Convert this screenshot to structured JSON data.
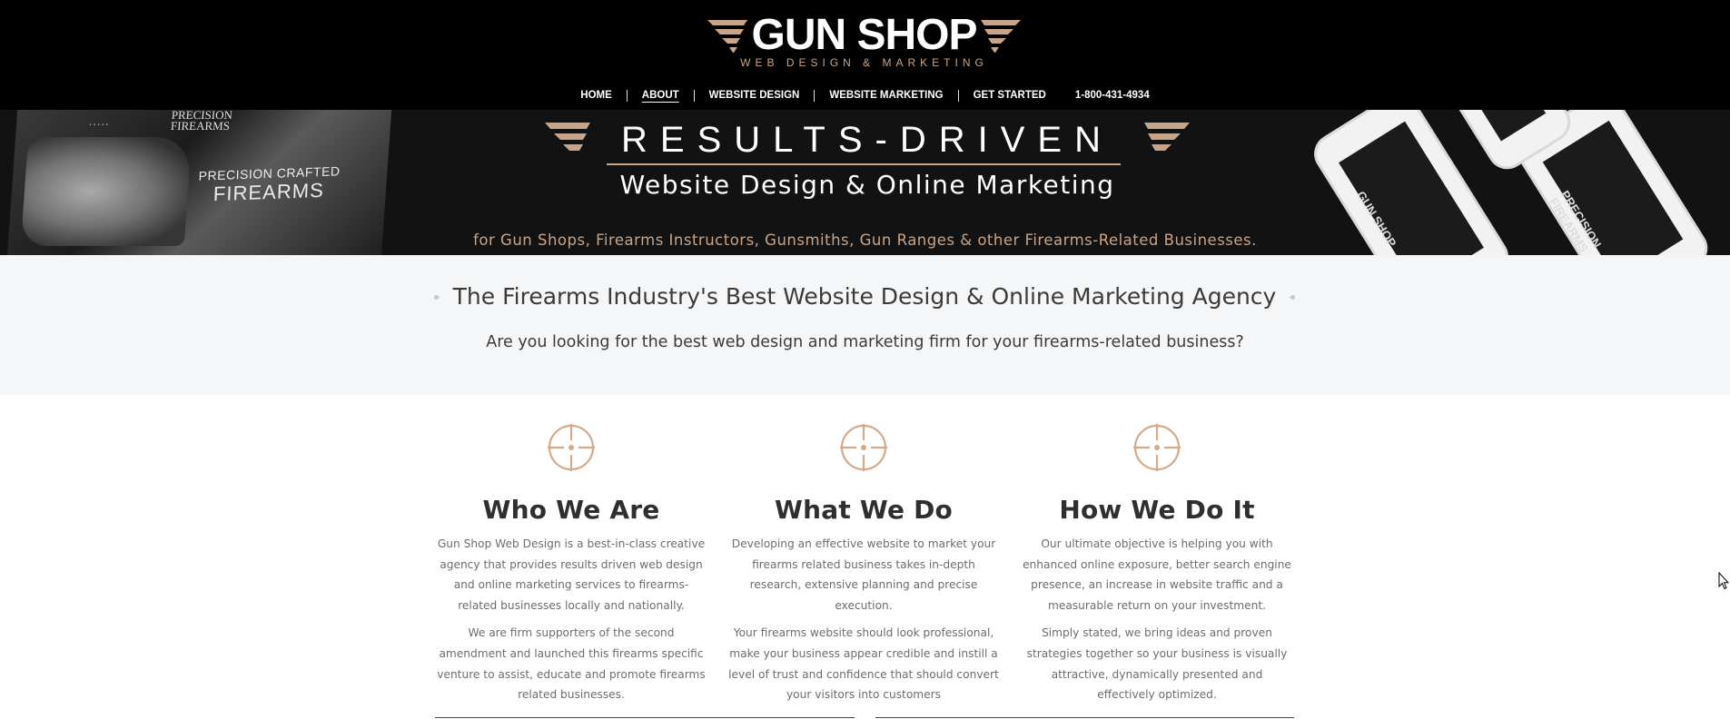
{
  "header": {
    "logo": {
      "title": "GUN SHOP",
      "subtitle": "WEB DESIGN & MARKETING"
    },
    "nav": [
      {
        "label": "HOME",
        "active": false
      },
      {
        "label": "ABOUT",
        "active": true
      },
      {
        "label": "WEBSITE DESIGN",
        "active": false
      },
      {
        "label": "WEBSITE MARKETING",
        "active": false
      },
      {
        "label": "GET STARTED",
        "active": false
      }
    ],
    "phone": "1-800-431-4934"
  },
  "banner": {
    "title": "RESULTS-DRIVEN",
    "subtitle": "Website Design & Online Marketing",
    "tagline": "for Gun Shops, Firearms Instructors, Gunsmiths, Gun Ranges & other Firearms-Related Businesses.",
    "left_mockup": {
      "logo_line1": "PRECISION",
      "logo_line2": "FIREARMS",
      "headline_small": "PRECISION CRAFTED",
      "headline_big": "FIREARMS"
    },
    "phone_brand_1": "GUN SHOP",
    "phone_brand_2": "PRECISION FIREARMS"
  },
  "intro": {
    "title": "The Firearms Industry's Best Website Design & Online Marketing Agency",
    "subtitle": "Are you looking for the best web design and marketing firm for your firearms-related business?"
  },
  "columns": [
    {
      "icon": "crosshair-icon",
      "title": "Who We Are",
      "paragraphs": [
        "Gun Shop Web Design is a best-in-class creative agency that provides results driven web design and online marketing services to firearms-related businesses locally and nationally.",
        "We are firm supporters of the second amendment and launched this firearms specific venture to assist, educate and promote firearms related businesses."
      ]
    },
    {
      "icon": "crosshair-icon",
      "title": "What We Do",
      "paragraphs": [
        "Developing an effective website to market your firearms related business takes in-depth research, extensive planning and precise execution.",
        "Your firearms website should look professional, make your business appear credible and instill a level of trust and confidence that should convert your visitors into customers"
      ]
    },
    {
      "icon": "crosshair-icon",
      "title": "How We Do It",
      "paragraphs": [
        "Our ultimate objective is helping you with enhanced online exposure, better search engine presence, an increase in website traffic and a measurable return on your investment.",
        "Simply stated, we bring ideas and proven strategies together so your business is visually attractive, dynamically presented and effectively optimized."
      ]
    }
  ],
  "colors": {
    "accent": "#c9a487",
    "header_bg": "#000000",
    "intro_bg": "#f5f6f7",
    "body_text": "#6d6d6d"
  }
}
